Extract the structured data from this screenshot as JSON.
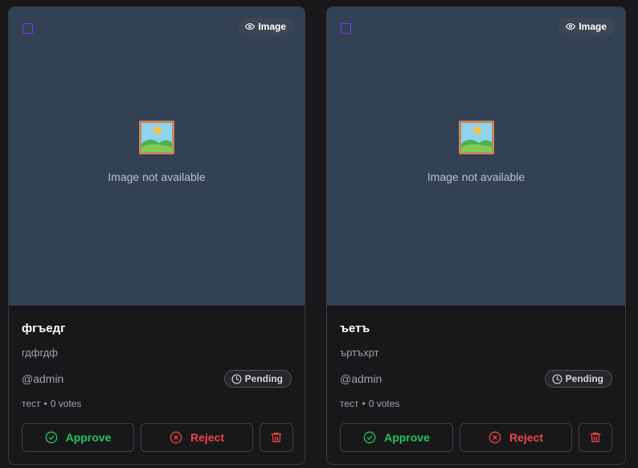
{
  "colors": {
    "approve": "#22c55e",
    "reject": "#ef4444",
    "select_border": "#7c3aed",
    "media_bg": "#334155"
  },
  "cards": [
    {
      "type_label": "Image",
      "placeholder_icon": "framed-picture-icon",
      "placeholder_text": "Image not available",
      "title": "фгъедг",
      "description": "гдфгдф",
      "author": "@admin",
      "status": "Pending",
      "category": "тест",
      "separator": "•",
      "votes": "0 votes",
      "approve_label": "Approve",
      "reject_label": "Reject"
    },
    {
      "type_label": "Image",
      "placeholder_icon": "framed-picture-icon",
      "placeholder_text": "Image not available",
      "title": "ъетъ",
      "description": "ъртъхрт",
      "author": "@admin",
      "status": "Pending",
      "category": "тест",
      "separator": "•",
      "votes": "0 votes",
      "approve_label": "Approve",
      "reject_label": "Reject"
    }
  ]
}
